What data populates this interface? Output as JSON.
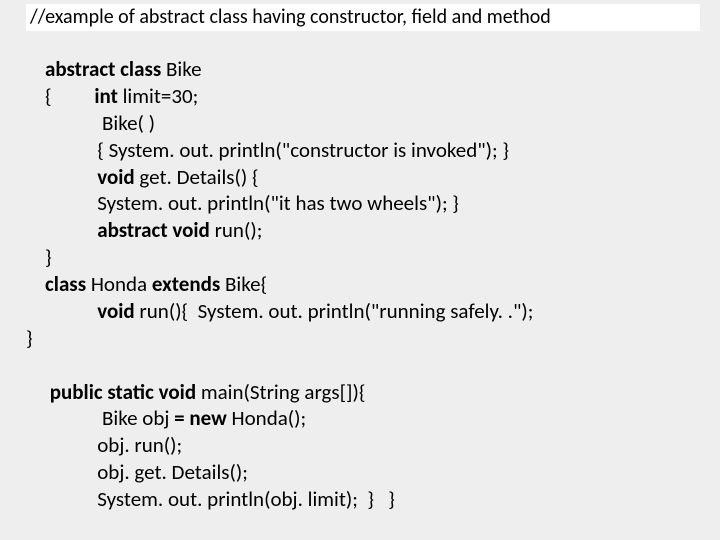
{
  "title": "//example of abstract class having constructor, field and method",
  "code": {
    "l1a": "abstract class",
    "l1b": " Bike",
    "l2a": "{",
    "l2b": "int",
    "l2c": " limit=30;",
    "l3": " Bike( )",
    "l4": "{ System. out. println(\"constructor is invoked\"); }",
    "l5a": "void",
    "l5b": " get. Details() {",
    "l6": "System. out. println(\"it has two wheels\"); }",
    "l7a": "abstract void",
    "l7b": " run();",
    "l8": "}",
    "l9a": "class",
    "l9b": " Honda",
    "l9c": " extends",
    "l9d": " Bike{",
    "l10a": "void",
    "l10b": " run(){  System. out. println(\"running safely. .\");",
    "l11": "}",
    "l12a": "public static void",
    "l12b": " main(String args[]){",
    "l13a": " Bike obj",
    "l13b": " = new",
    "l13c": " Honda();",
    "l14": "obj. run();",
    "l15": "obj. get. Details();",
    "l16": "System. out. println(obj. limit);  }   }"
  }
}
